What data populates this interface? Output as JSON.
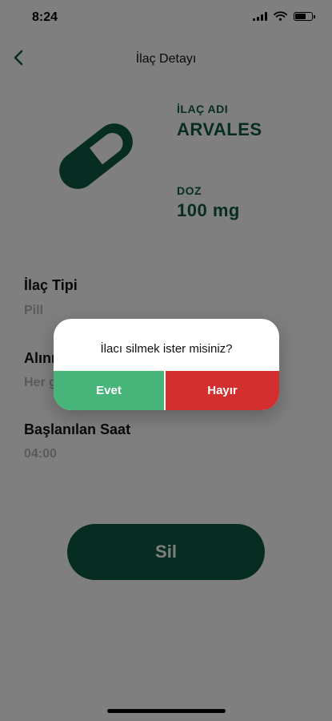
{
  "status_bar": {
    "time": "8:24"
  },
  "nav": {
    "title": "İlaç Detayı"
  },
  "medicine": {
    "name_label": "İLAÇ ADI",
    "name": "ARVALES",
    "dose_label": "DOZ",
    "dose": "100 mg"
  },
  "details": [
    {
      "label": "İlaç Tipi",
      "value": "Pill"
    },
    {
      "label": "Alınma Sıklığı",
      "value": "Her gün"
    },
    {
      "label": "Başlanılan Saat",
      "value": "04:00"
    }
  ],
  "delete_button": {
    "label": "Sil"
  },
  "dialog": {
    "message": "İlacı silmek ister misiniz?",
    "yes_label": "Evet",
    "no_label": "Hayır"
  },
  "colors": {
    "primary": "#0f5a45",
    "yes": "#47b579",
    "no": "#d32f2f",
    "muted": "#b5b5b5"
  },
  "icons": {
    "back": "chevron-left-icon",
    "medicine": "pill-capsule-icon",
    "wifi": "wifi-icon",
    "battery": "battery-icon",
    "signal": "cellular-signal-icon"
  }
}
